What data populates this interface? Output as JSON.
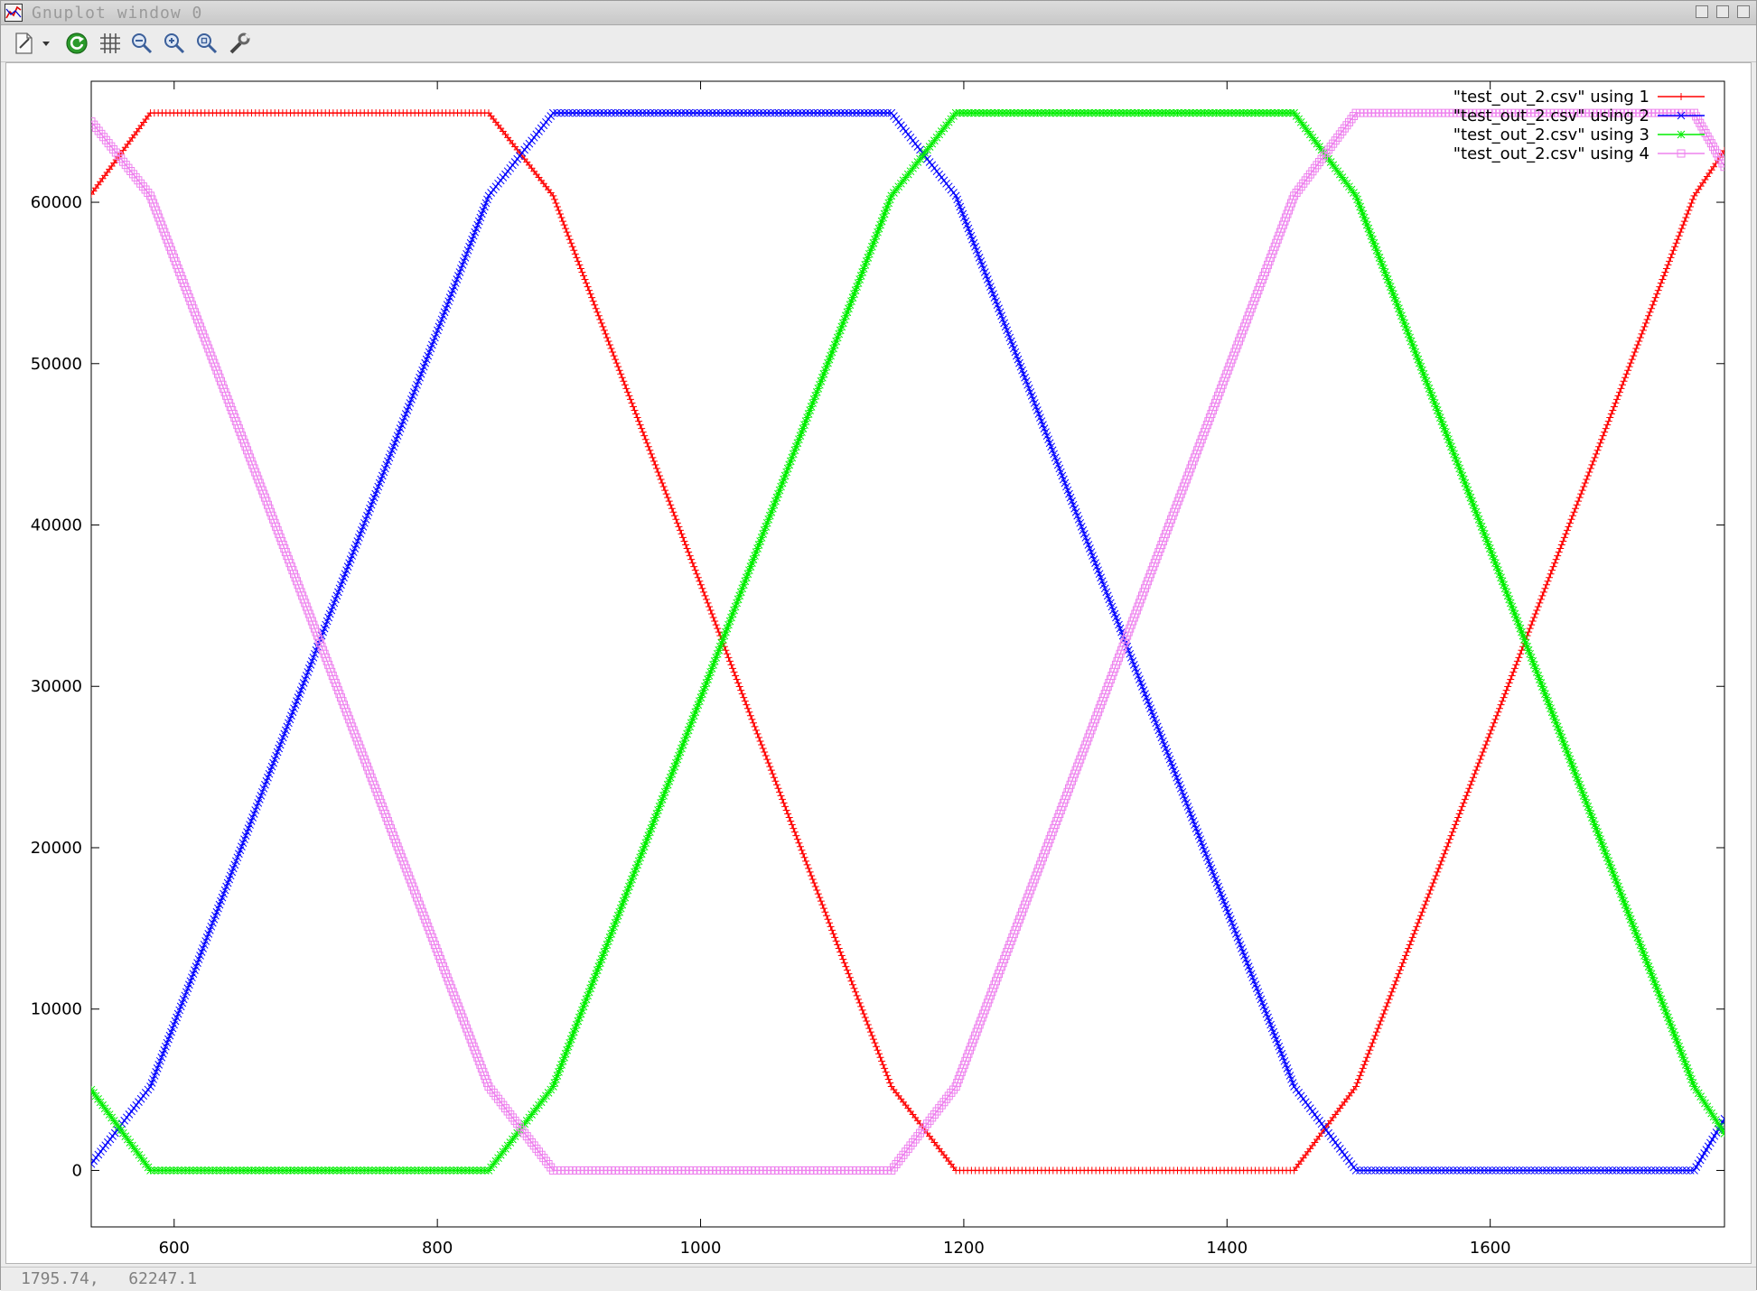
{
  "window": {
    "title": "Gnuplot window 0",
    "status_text": "1795.74,   62247.1"
  },
  "toolbar": {
    "buttons": [
      {
        "name": "export-menu",
        "icon": "document-export-icon"
      },
      {
        "name": "replot",
        "icon": "refresh-icon"
      },
      {
        "name": "grid",
        "icon": "grid-icon"
      },
      {
        "name": "zoom-back",
        "icon": "zoom-previous-icon"
      },
      {
        "name": "zoom-forward",
        "icon": "zoom-next-icon"
      },
      {
        "name": "autoscale",
        "icon": "zoom-fit-icon"
      },
      {
        "name": "settings",
        "icon": "wrench-icon"
      }
    ]
  },
  "chart_data": {
    "type": "line",
    "title": "",
    "xlabel": "",
    "ylabel": "",
    "xlim": [
      537,
      1778
    ],
    "ylim": [
      -3500,
      67500
    ],
    "xticks": [
      600,
      800,
      1000,
      1200,
      1400,
      1600
    ],
    "yticks": [
      0,
      10000,
      20000,
      30000,
      40000,
      50000,
      60000
    ],
    "grid": false,
    "legend_position": "top-right",
    "series": [
      {
        "name": "\"test_out_2.csv\" using 1",
        "color": "#ff0000",
        "marker": "plus",
        "points": [
          [
            537,
            60500
          ],
          [
            582,
            65535
          ],
          [
            839,
            65535
          ],
          [
            888,
            60400
          ],
          [
            1145,
            5200
          ],
          [
            1194,
            0
          ],
          [
            1451,
            0
          ],
          [
            1498,
            5200
          ],
          [
            1755,
            60400
          ],
          [
            1778,
            63200
          ]
        ]
      },
      {
        "name": "\"test_out_2.csv\" using 2",
        "color": "#0000ff",
        "marker": "x",
        "points": [
          [
            537,
            400
          ],
          [
            582,
            5200
          ],
          [
            839,
            60400
          ],
          [
            888,
            65535
          ],
          [
            1145,
            65535
          ],
          [
            1194,
            60400
          ],
          [
            1451,
            5200
          ],
          [
            1498,
            0
          ],
          [
            1755,
            0
          ],
          [
            1778,
            3200
          ]
        ]
      },
      {
        "name": "\"test_out_2.csv\" using 3",
        "color": "#00ee00",
        "marker": "star",
        "points": [
          [
            537,
            5000
          ],
          [
            582,
            0
          ],
          [
            839,
            0
          ],
          [
            888,
            5200
          ],
          [
            1145,
            60400
          ],
          [
            1194,
            65535
          ],
          [
            1451,
            65535
          ],
          [
            1498,
            60400
          ],
          [
            1755,
            5200
          ],
          [
            1778,
            2300
          ]
        ]
      },
      {
        "name": "\"test_out_2.csv\" using 4",
        "color": "#ee82ee",
        "marker": "box",
        "points": [
          [
            537,
            65000
          ],
          [
            582,
            60400
          ],
          [
            839,
            5200
          ],
          [
            888,
            0
          ],
          [
            1145,
            0
          ],
          [
            1194,
            5200
          ],
          [
            1451,
            60400
          ],
          [
            1498,
            65535
          ],
          [
            1755,
            65535
          ],
          [
            1778,
            62200
          ]
        ]
      }
    ]
  }
}
